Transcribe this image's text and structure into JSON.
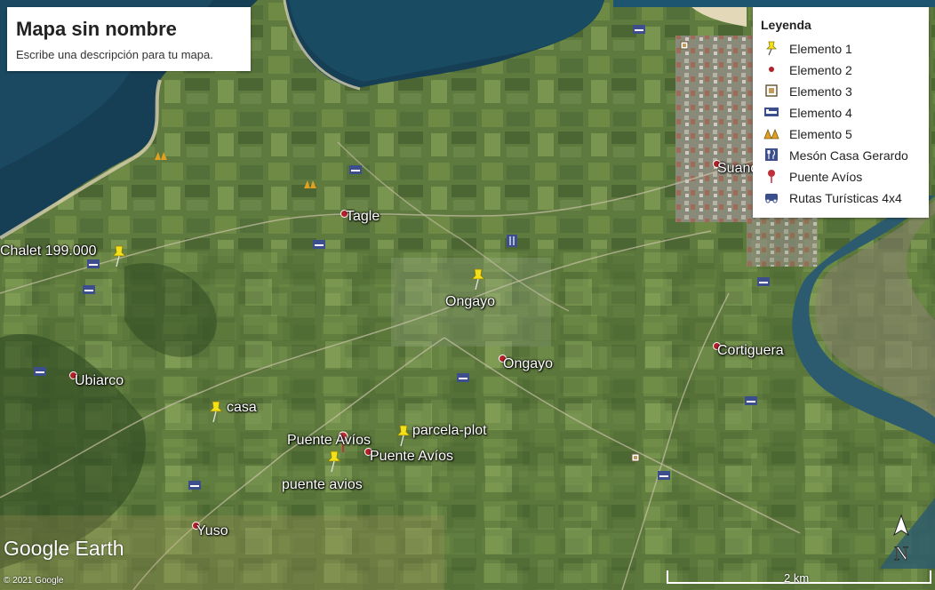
{
  "title_panel": {
    "title": "Mapa sin nombre",
    "description": "Escribe una descripción para tu mapa."
  },
  "legend": {
    "heading": "Leyenda",
    "items": [
      {
        "label": "Elemento 1",
        "icon": "yellow-pushpin-icon"
      },
      {
        "label": "Elemento 2",
        "icon": "red-dot-icon"
      },
      {
        "label": "Elemento 3",
        "icon": "square-poi-icon"
      },
      {
        "label": "Elemento 4",
        "icon": "bed-icon"
      },
      {
        "label": "Elemento 5",
        "icon": "tent-icon"
      },
      {
        "label": "Mesón Casa Gerardo",
        "icon": "fork-knife-icon"
      },
      {
        "label": "Puente Avíos",
        "icon": "red-pin-icon"
      },
      {
        "label": "Rutas Turísticas 4x4",
        "icon": "jeep-icon"
      }
    ]
  },
  "places": {
    "chalet": "Chalet 199.000",
    "tagle": "Tagle",
    "ongayo_pin": "Ongayo",
    "ongayo_dot": "Ongayo",
    "ubiarco": "Ubiarco",
    "casa": "casa",
    "puente_avios_pin": "Puente Avíos",
    "parcela": "parcela-plot",
    "puente_avios_dot": "Puente Avíos",
    "puente_avios_lower": "puente avios",
    "yuso": "Yuso",
    "suances": "Suances",
    "cortiguera": "Cortiguera"
  },
  "branding": {
    "logo": "Google Earth",
    "copyright": "© 2021 Google"
  },
  "scale": {
    "label": "2 km"
  },
  "compass": {
    "label": "N"
  },
  "colors": {
    "sea": "#163f55",
    "river": "#2c5a6e",
    "land": "#5f7a3e",
    "pin_yellow": "#f5e11a",
    "dot_red": "#b3202a"
  }
}
